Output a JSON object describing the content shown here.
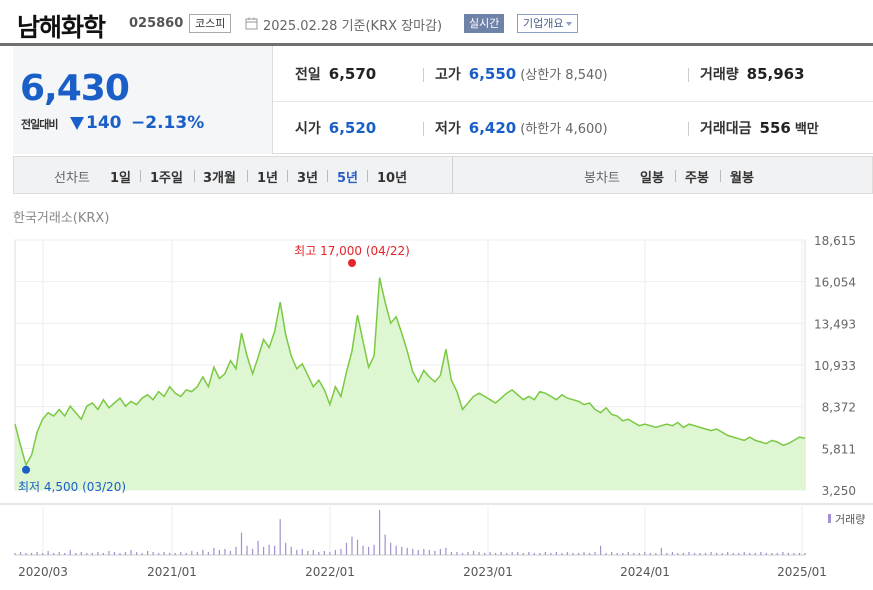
{
  "header": {
    "name": "남해화학",
    "code": "025860",
    "market": "코스피",
    "base_date": "2025.02.28 기준(KRX 장마감)",
    "realtime": "실시간",
    "company_info": "기업개요"
  },
  "price": {
    "current": "6,430",
    "diff_label": "전일대비",
    "diff_value": "140",
    "diff_pct": "−2.13%"
  },
  "info": {
    "prev_label": "전일",
    "prev": "6,570",
    "high_label": "고가",
    "high": "6,550",
    "upper_limit": "(상한가 8,540)",
    "volume_label": "거래량",
    "volume": "85,963",
    "open_label": "시가",
    "open": "6,520",
    "low_label": "저가",
    "low": "6,420",
    "lower_limit": "(하한가 4,600)",
    "amount_label": "거래대금",
    "amount": "556",
    "amount_unit": "백만"
  },
  "periods": {
    "line_label": "선차트",
    "line_items": [
      "1일",
      "1주일",
      "3개월",
      "1년",
      "3년",
      "5년",
      "10년"
    ],
    "active": "5년",
    "candle_label": "봉차트",
    "candle_items": [
      "일봉",
      "주봉",
      "월봉"
    ]
  },
  "exchange": "한국거래소(KRX)",
  "colors": {
    "up": "#e5242b",
    "down": "#1a5fc8",
    "line": "#7ac943",
    "area": "#dcf5cd",
    "volume": "#a48fd0"
  },
  "chart_data": {
    "type": "area",
    "x_labels": [
      "2020/03",
      "2021/01",
      "2022/01",
      "2023/01",
      "2024/01",
      "2025/01"
    ],
    "y_ticks": [
      "18,615",
      "16,054",
      "13,493",
      "10,933",
      "8,372",
      "5,811",
      "3,250"
    ],
    "ylim": [
      3250,
      18615
    ],
    "max_label": "최고 17,000 (04/22)",
    "min_label": "최저 4,500 (03/20)",
    "volume_legend": "거래량",
    "series": [
      {
        "values": [
          7300,
          6000,
          4800,
          5400,
          6800,
          7600,
          8000,
          7800,
          8200,
          7800,
          8400,
          8000,
          7600,
          8400,
          8600,
          8200,
          8800,
          8300,
          8600,
          8900,
          8400,
          8700,
          8500,
          8900,
          9100,
          8800,
          9300,
          9000,
          9600,
          9200,
          9000,
          9400,
          9300,
          9600,
          10200,
          9600,
          10800,
          10100,
          10400,
          11200,
          10700,
          12900,
          11500,
          10400,
          11400,
          12500,
          12000,
          13000,
          14800,
          12800,
          11500,
          10700,
          11000,
          10300,
          9600,
          10000,
          9400,
          8500,
          9600,
          9000,
          10500,
          11800,
          14000,
          12400,
          10800,
          11500,
          16300,
          14800,
          13500,
          13900,
          12900,
          11800,
          10500,
          9900,
          10600,
          10200,
          9900,
          10300,
          11900,
          10000,
          9300,
          8200,
          8600,
          9000,
          9200,
          9000,
          8800,
          8600,
          8900,
          9200,
          9400,
          9100,
          8800,
          9000,
          8800,
          9300,
          9200,
          9000,
          8800,
          9100,
          8900,
          8800,
          8700,
          8500,
          8600,
          8200,
          8000,
          8300,
          7900,
          7800,
          7500,
          7600,
          7400,
          7200,
          7300,
          7200,
          7100,
          7200,
          7300,
          7200,
          7400,
          7100,
          7300,
          7200,
          7100,
          7000,
          6900,
          7000,
          6800,
          6600,
          6500,
          6400,
          6300,
          6500,
          6300,
          6200,
          6100,
          6300,
          6200,
          6000,
          6100,
          6300,
          6500,
          6430
        ]
      }
    ],
    "volume": [
      2,
      3,
      2,
      2,
      3,
      2,
      4,
      2,
      3,
      2,
      5,
      2,
      3,
      2,
      2,
      3,
      2,
      4,
      3,
      2,
      3,
      5,
      3,
      2,
      4,
      3,
      2,
      3,
      2,
      2,
      3,
      2,
      4,
      3,
      5,
      3,
      7,
      5,
      6,
      4,
      8,
      22,
      9,
      6,
      14,
      8,
      10,
      9,
      35,
      12,
      8,
      5,
      6,
      4,
      5,
      3,
      4,
      3,
      5,
      6,
      12,
      18,
      15,
      9,
      8,
      10,
      44,
      20,
      12,
      9,
      8,
      7,
      6,
      5,
      6,
      5,
      4,
      6,
      7,
      3,
      3,
      2,
      3,
      4,
      3,
      2,
      3,
      2,
      3,
      2,
      3,
      3,
      2,
      3,
      2,
      2,
      3,
      2,
      3,
      2,
      3,
      2,
      2,
      3,
      2,
      3,
      9,
      2,
      3,
      2,
      2,
      3,
      2,
      2,
      3,
      2,
      2,
      7,
      2,
      3,
      2,
      2,
      3,
      2,
      2,
      2,
      3,
      2,
      2,
      3,
      2,
      2,
      3,
      2,
      2,
      3,
      2,
      2,
      2,
      3,
      2,
      2,
      2,
      2
    ]
  }
}
